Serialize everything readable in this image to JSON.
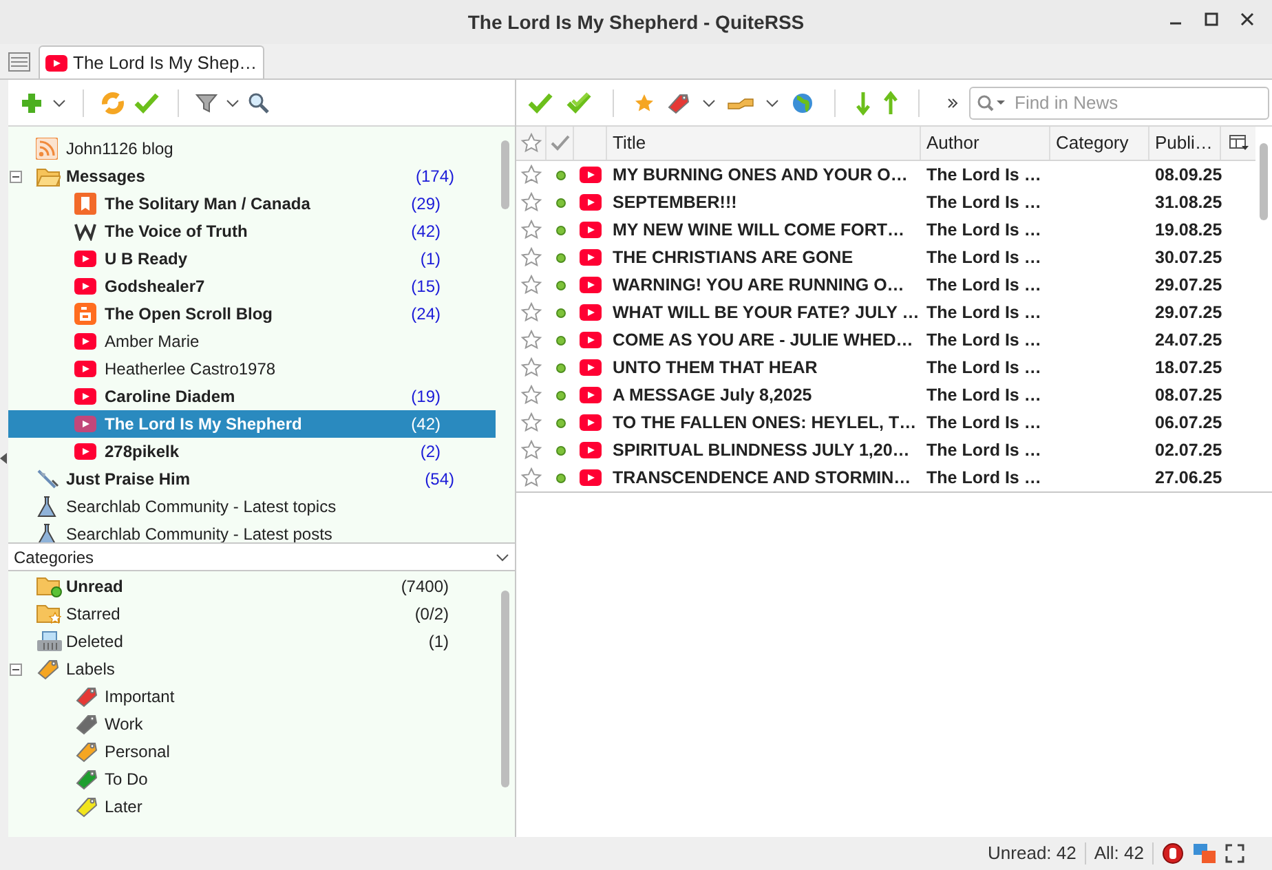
{
  "window": {
    "title": "The Lord Is My Shepherd - QuiteRSS"
  },
  "tabs": [
    {
      "label": "The Lord Is My Shep…",
      "selected": true
    }
  ],
  "feeds": [
    {
      "kind": "rss",
      "name": "John1126 blog",
      "bold": false,
      "selected": false
    },
    {
      "kind": "folder",
      "name": "Messages",
      "count": "(174)",
      "bold": true,
      "selected": false,
      "expanded": true,
      "children": [
        {
          "kind": "bookmark",
          "name": "The Solitary Man / Canada",
          "count": "(29)",
          "bold": true,
          "selected": false
        },
        {
          "kind": "w",
          "name": "The Voice of Truth",
          "count": "(42)",
          "bold": true,
          "selected": false
        },
        {
          "kind": "youtube",
          "name": "U B Ready",
          "count": "(1)",
          "bold": true,
          "selected": false
        },
        {
          "kind": "youtube",
          "name": "Godshealer7",
          "count": "(15)",
          "bold": true,
          "selected": false
        },
        {
          "kind": "blogger",
          "name": "The Open Scroll Blog",
          "count": "(24)",
          "bold": true,
          "selected": false
        },
        {
          "kind": "youtube",
          "name": "Amber Marie",
          "bold": false,
          "selected": false
        },
        {
          "kind": "youtube",
          "name": "Heatherlee Castro1978",
          "bold": false,
          "selected": false
        },
        {
          "kind": "youtube",
          "name": "Caroline Diadem",
          "count": "(19)",
          "bold": true,
          "selected": false
        },
        {
          "kind": "youtube",
          "name": "The Lord Is My Shepherd",
          "count": "(42)",
          "bold": true,
          "selected": true
        },
        {
          "kind": "youtube",
          "name": "278pikelk",
          "count": "(2)",
          "bold": true,
          "selected": false
        }
      ]
    },
    {
      "kind": "wand",
      "name": "Just Praise Him",
      "count": "(54)",
      "bold": true,
      "selected": false
    },
    {
      "kind": "flask",
      "name": "Searchlab Community - Latest topics",
      "bold": false,
      "selected": false
    },
    {
      "kind": "flask",
      "name": "Searchlab Community - Latest posts",
      "bold": false,
      "selected": false
    }
  ],
  "categories": {
    "title": "Categories",
    "items": [
      {
        "kind": "unread",
        "name": "Unread",
        "count": "(7400)",
        "bold": true
      },
      {
        "kind": "starred",
        "name": "Starred",
        "count": "(0/2)",
        "bold": false
      },
      {
        "kind": "deleted",
        "name": "Deleted",
        "count": "(1)",
        "bold": false
      },
      {
        "kind": "labels",
        "name": "Labels",
        "bold": false,
        "expanded": true,
        "children": [
          {
            "kind": "label",
            "name": "Important",
            "color": "#e53935"
          },
          {
            "kind": "label",
            "name": "Work",
            "color": "#6b6b6b"
          },
          {
            "kind": "label",
            "name": "Personal",
            "color": "#f5a623"
          },
          {
            "kind": "label",
            "name": "To Do",
            "color": "#1e9e2e"
          },
          {
            "kind": "label",
            "name": "Later",
            "color": "#f2e51c"
          }
        ]
      }
    ]
  },
  "search": {
    "placeholder": "Find in News"
  },
  "table": {
    "columns": [
      "Title",
      "Author",
      "Category",
      "Publi…"
    ],
    "rows": [
      {
        "starred": false,
        "unread": true,
        "title": "MY BURNING ONES AND YOUR O…",
        "author": "The Lord Is …",
        "date": "08.09.25"
      },
      {
        "starred": false,
        "unread": true,
        "title": "SEPTEMBER!!!",
        "author": "The Lord Is …",
        "date": "31.08.25"
      },
      {
        "starred": false,
        "unread": true,
        "title": "MY NEW WINE WILL COME FORT…",
        "author": "The Lord Is …",
        "date": "19.08.25"
      },
      {
        "starred": false,
        "unread": true,
        "title": "THE CHRISTIANS ARE GONE",
        "author": "The Lord Is …",
        "date": "30.07.25"
      },
      {
        "starred": false,
        "unread": true,
        "title": "WARNING! YOU ARE RUNNING O…",
        "author": "The Lord Is …",
        "date": "29.07.25"
      },
      {
        "starred": false,
        "unread": true,
        "title": "WHAT WILL BE YOUR FATE? JULY …",
        "author": "The Lord Is …",
        "date": "29.07.25"
      },
      {
        "starred": false,
        "unread": true,
        "title": "COME AS YOU ARE - JULIE WHED…",
        "author": "The Lord Is …",
        "date": "24.07.25"
      },
      {
        "starred": false,
        "unread": true,
        "title": "UNTO THEM THAT HEAR",
        "author": "The Lord Is …",
        "date": "18.07.25"
      },
      {
        "starred": false,
        "unread": true,
        "title": "A MESSAGE July 8,2025",
        "author": "The Lord Is …",
        "date": "08.07.25"
      },
      {
        "starred": false,
        "unread": true,
        "title": "TO THE FALLEN ONES: HEYLEL, T…",
        "author": "The Lord Is …",
        "date": "06.07.25"
      },
      {
        "starred": false,
        "unread": true,
        "title": "SPIRITUAL BLINDNESS JULY 1,20…",
        "author": "The Lord Is …",
        "date": "02.07.25"
      },
      {
        "starred": false,
        "unread": true,
        "title": "TRANSCENDENCE AND STORMIN…",
        "author": "The Lord Is …",
        "date": "27.06.25"
      }
    ]
  },
  "status_bar": {
    "unread": "Unread: 42",
    "all": "All: 42"
  }
}
